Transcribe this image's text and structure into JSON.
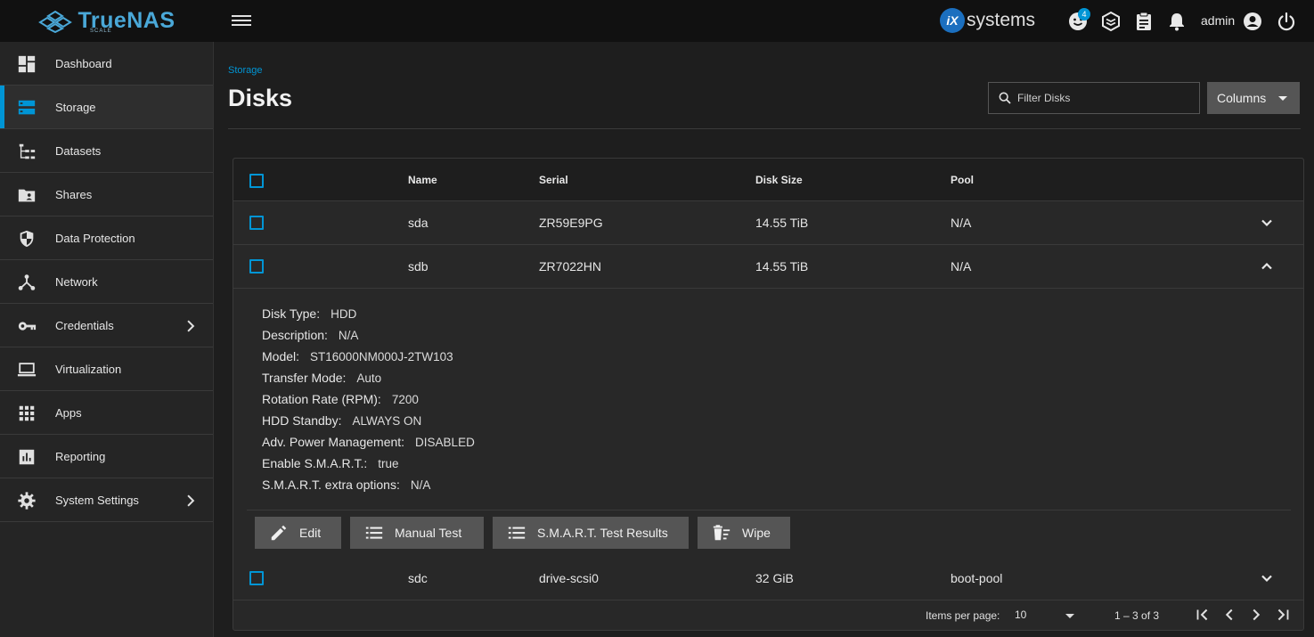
{
  "brand": {
    "name": "TrueNAS",
    "edition": "SCALE"
  },
  "header": {
    "vendor_logo_mark": "iX",
    "vendor_logo_text": "systems",
    "jobs_badge": "4",
    "user": "admin",
    "icons": [
      "feedback-icon",
      "truecommand-icon",
      "jobs-clipboard-icon",
      "notifications-bell-icon",
      "account-circle-icon",
      "power-icon"
    ]
  },
  "sidebar": {
    "items": [
      {
        "label": "Dashboard",
        "icon": "dashboard-icon"
      },
      {
        "label": "Storage",
        "icon": "storage-icon",
        "active": true
      },
      {
        "label": "Datasets",
        "icon": "datasets-icon"
      },
      {
        "label": "Shares",
        "icon": "shares-folder-icon"
      },
      {
        "label": "Data Protection",
        "icon": "shield-icon"
      },
      {
        "label": "Network",
        "icon": "network-icon"
      },
      {
        "label": "Credentials",
        "icon": "key-icon",
        "expandable": true
      },
      {
        "label": "Virtualization",
        "icon": "laptop-icon"
      },
      {
        "label": "Apps",
        "icon": "apps-grid-icon"
      },
      {
        "label": "Reporting",
        "icon": "reporting-chart-icon"
      },
      {
        "label": "System Settings",
        "icon": "gear-icon",
        "expandable": true
      }
    ]
  },
  "page": {
    "breadcrumb": "Storage",
    "title": "Disks",
    "filter_placeholder": "Filter Disks",
    "columns_button": "Columns"
  },
  "table": {
    "headers": {
      "name": "Name",
      "serial": "Serial",
      "size": "Disk Size",
      "pool": "Pool"
    },
    "rows": [
      {
        "name": "sda",
        "serial": "ZR59E9PG",
        "size": "14.55 TiB",
        "pool": "N/A",
        "expanded": false
      },
      {
        "name": "sdb",
        "serial": "ZR7022HN",
        "size": "14.55 TiB",
        "pool": "N/A",
        "expanded": true
      },
      {
        "name": "sdc",
        "serial": "drive-scsi0",
        "size": "32 GiB",
        "pool": "boot-pool",
        "expanded": false
      }
    ],
    "details": [
      {
        "label": "Disk Type:",
        "value": "HDD"
      },
      {
        "label": "Description:",
        "value": "N/A"
      },
      {
        "label": "Model:",
        "value": "ST16000NM000J-2TW103"
      },
      {
        "label": "Transfer Mode:",
        "value": "Auto"
      },
      {
        "label": "Rotation Rate (RPM):",
        "value": "7200"
      },
      {
        "label": "HDD Standby:",
        "value": "ALWAYS ON"
      },
      {
        "label": "Adv. Power Management:",
        "value": "DISABLED"
      },
      {
        "label": "Enable S.M.A.R.T.:",
        "value": "true"
      },
      {
        "label": "S.M.A.R.T. extra options:",
        "value": "N/A"
      }
    ],
    "actions": {
      "edit": "Edit",
      "manual_test": "Manual Test",
      "smart_results": "S.M.A.R.T. Test Results",
      "wipe": "Wipe"
    }
  },
  "paginator": {
    "items_per_page_label": "Items per page:",
    "items_per_page": "10",
    "range": "1 – 3 of 3"
  },
  "colors": {
    "accent": "#0095d5",
    "topbar": "#111111",
    "sidebar": "#252525",
    "content": "#1e1e1e",
    "button": "#555555"
  }
}
